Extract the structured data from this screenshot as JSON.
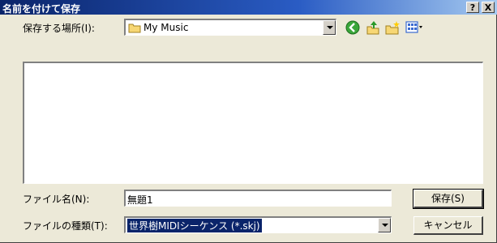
{
  "window": {
    "title": "名前を付けて保存",
    "help_label": "?",
    "close_label": "X"
  },
  "location": {
    "label": "保存する場所(I):",
    "value": "My Music"
  },
  "filename": {
    "label": "ファイル名(N):",
    "value": "無題1"
  },
  "filetype": {
    "label": "ファイルの種類(T):",
    "value": "世界樹MIDIシーケンス (*.skj)"
  },
  "buttons": {
    "save": "保存(S)",
    "cancel": "キャンセル"
  },
  "colors": {
    "title_start": "#0a246a",
    "title_end": "#a6caf0",
    "face": "#ece9d8",
    "selection": "#0a246a"
  },
  "icons": [
    "folder-icon",
    "back-icon",
    "up-folder-icon",
    "new-folder-icon",
    "view-menu-icon"
  ]
}
